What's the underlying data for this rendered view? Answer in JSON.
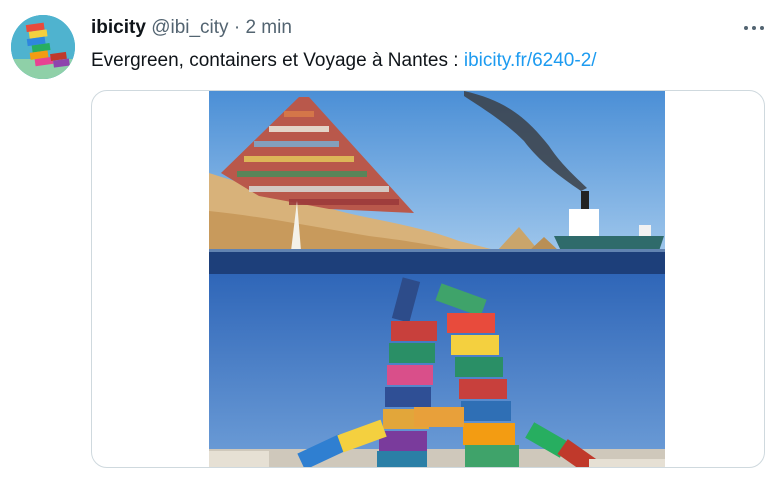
{
  "tweet": {
    "name": "ibicity",
    "handle": "@ibi_city",
    "separator": "·",
    "time": "2 min",
    "text": "Evergreen, containers et Voyage à Nantes : ",
    "link": "ibicity.fr/6240-2/"
  },
  "icons": {
    "more": "more-dots-icon",
    "avatar": "container-stack-avatar"
  },
  "colors": {
    "link": "#1d9bf0",
    "secondary_text": "#536471",
    "primary_text": "#0f1419",
    "border": "#cfd9de"
  }
}
